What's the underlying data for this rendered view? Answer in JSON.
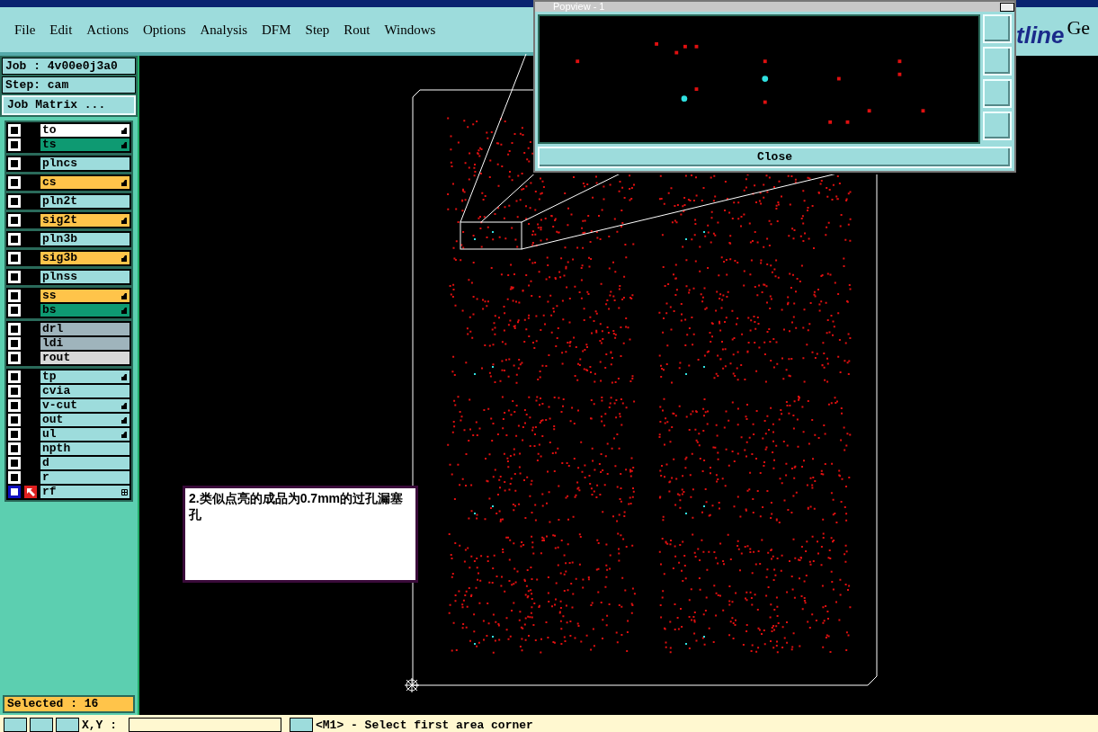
{
  "menu": [
    "File",
    "Edit",
    "Actions",
    "Options",
    "Analysis",
    "DFM",
    "Step",
    "Rout",
    "Windows"
  ],
  "logo": {
    "text": "tline",
    "text_2": "Ge"
  },
  "job": {
    "job": "Job : 4v00e0j3a0",
    "step": "Step: cam",
    "matrix_button": "Job Matrix ..."
  },
  "layer_groups": [
    [
      {
        "name": "to",
        "color": "#ffffff",
        "affected": true,
        "work": false,
        "checked": false
      },
      {
        "name": "ts",
        "color": "#0e9a72",
        "affected": true,
        "work": false,
        "checked": false
      }
    ],
    [
      {
        "name": "plncs",
        "color": "#9ddcdc",
        "affected": false,
        "work": false,
        "checked": false
      }
    ],
    [
      {
        "name": "cs",
        "color": "#ffc44a",
        "affected": true,
        "work": false,
        "checked": false
      }
    ],
    [
      {
        "name": "pln2t",
        "color": "#9ddcdc",
        "affected": false,
        "work": false,
        "checked": false
      }
    ],
    [
      {
        "name": "sig2t",
        "color": "#ffc44a",
        "affected": true,
        "work": false,
        "checked": false
      }
    ],
    [
      {
        "name": "pln3b",
        "color": "#9ddcdc",
        "affected": false,
        "work": false,
        "checked": false
      }
    ],
    [
      {
        "name": "sig3b",
        "color": "#ffc44a",
        "affected": true,
        "work": false,
        "checked": false
      }
    ],
    [
      {
        "name": "plnss",
        "color": "#9ddcdc",
        "affected": false,
        "work": false,
        "checked": false
      }
    ],
    [
      {
        "name": "ss",
        "color": "#ffc44a",
        "affected": true,
        "work": false,
        "checked": false
      },
      {
        "name": "bs",
        "color": "#0e9a72",
        "affected": true,
        "work": false,
        "checked": false
      }
    ],
    [
      {
        "name": "drl",
        "color": "#9fb4bc",
        "affected": false,
        "work": false,
        "checked": false
      },
      {
        "name": "ldi",
        "color": "#9fb4bc",
        "affected": false,
        "work": false,
        "checked": false
      },
      {
        "name": "rout",
        "color": "#d8d8d8",
        "affected": false,
        "work": false,
        "checked": false
      }
    ],
    [
      {
        "name": "tp",
        "color": "#9ddcdc",
        "affected": true,
        "work": false,
        "checked": false
      },
      {
        "name": "cvia",
        "color": "#9ddcdc",
        "affected": false,
        "work": false,
        "checked": false
      },
      {
        "name": "v-cut",
        "color": "#9ddcdc",
        "affected": true,
        "work": false,
        "checked": false
      },
      {
        "name": "out",
        "color": "#9ddcdc",
        "affected": true,
        "work": false,
        "checked": false
      },
      {
        "name": "ul",
        "color": "#9ddcdc",
        "affected": true,
        "work": false,
        "checked": false
      },
      {
        "name": "npth",
        "color": "#9ddcdc",
        "affected": false,
        "work": false,
        "checked": false
      },
      {
        "name": "d",
        "color": "#9ddcdc",
        "affected": false,
        "work": false,
        "checked": false
      },
      {
        "name": "r",
        "color": "#9ddcdc",
        "affected": false,
        "work": false,
        "checked": false
      },
      {
        "name": "rf",
        "color": "#9ddcdc",
        "affected": false,
        "work": true,
        "checked": false
      }
    ]
  ],
  "selected_count": "Selected : 16",
  "note": "2.类似点亮的成品为0.7mm的过孔漏塞孔",
  "popview": {
    "title": "Popview - 1",
    "close_button": "Close"
  },
  "status_bar": {
    "xy_label": "X,Y :",
    "message": "<M1> - Select first area corner"
  }
}
